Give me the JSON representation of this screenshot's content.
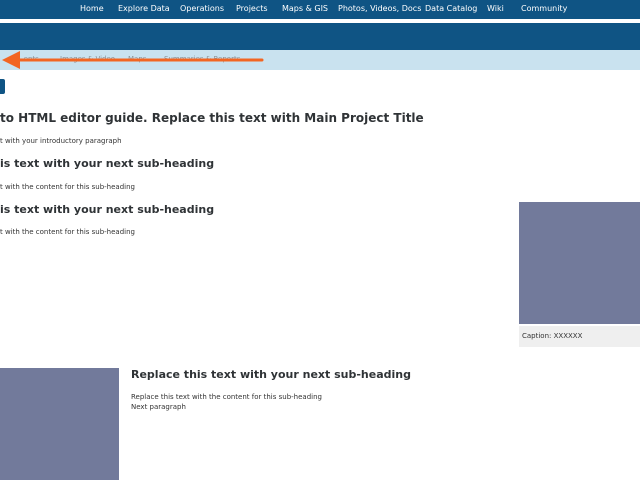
{
  "topnav": {
    "items": [
      "Home",
      "Explore Data",
      "Operations",
      "Projects",
      "Maps & GIS",
      "Photos, Videos, Docs",
      "Data Catalog",
      "Wiki",
      "Community"
    ]
  },
  "subnav": {
    "items": [
      "...ents",
      "Images & Video",
      "Maps",
      "Summaries & Reports"
    ]
  },
  "annotation": {
    "arrow_color": "#f26522"
  },
  "content": {
    "main_title": "to HTML editor guide. Replace this text with Main Project Title",
    "intro": "t with your introductory paragraph",
    "section1_heading": "is text with your next sub-heading",
    "section1_text": "t with the content for this sub-heading",
    "section2_heading": "is text with your next sub-heading",
    "section2_text": "t with the content for this sub-heading",
    "caption": "Caption: XXXXXX",
    "section3_heading": "Replace this text with your next sub-heading",
    "section3_text": "Replace this text with the content for this sub-heading",
    "section3_next": "Next paragraph"
  },
  "colors": {
    "nav_bg": "#0f5484",
    "subnav_bg": "#c9e2ef",
    "image_placeholder": "#727a9b"
  }
}
